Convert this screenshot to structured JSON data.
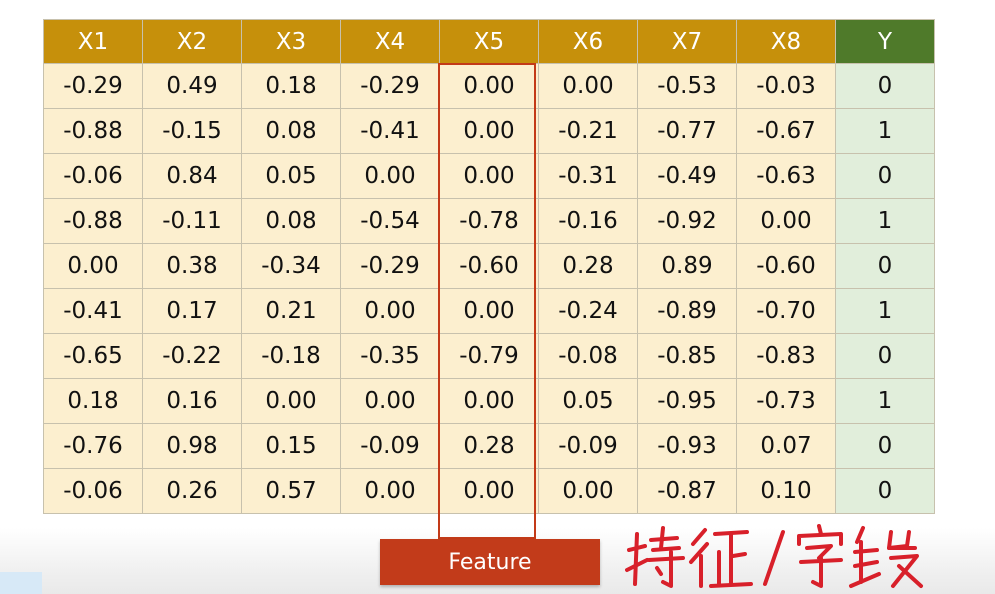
{
  "table": {
    "headers": [
      "X1",
      "X2",
      "X3",
      "X4",
      "X5",
      "X6",
      "X7",
      "X8",
      "Y"
    ],
    "rows": [
      [
        "-0.29",
        "0.49",
        "0.18",
        "-0.29",
        "0.00",
        "0.00",
        "-0.53",
        "-0.03",
        "0"
      ],
      [
        "-0.88",
        "-0.15",
        "0.08",
        "-0.41",
        "0.00",
        "-0.21",
        "-0.77",
        "-0.67",
        "1"
      ],
      [
        "-0.06",
        "0.84",
        "0.05",
        "0.00",
        "0.00",
        "-0.31",
        "-0.49",
        "-0.63",
        "0"
      ],
      [
        "-0.88",
        "-0.11",
        "0.08",
        "-0.54",
        "-0.78",
        "-0.16",
        "-0.92",
        "0.00",
        "1"
      ],
      [
        "0.00",
        "0.38",
        "-0.34",
        "-0.29",
        "-0.60",
        "0.28",
        "0.89",
        "-0.60",
        "0"
      ],
      [
        "-0.41",
        "0.17",
        "0.21",
        "0.00",
        "0.00",
        "-0.24",
        "-0.89",
        "-0.70",
        "1"
      ],
      [
        "-0.65",
        "-0.22",
        "-0.18",
        "-0.35",
        "-0.79",
        "-0.08",
        "-0.85",
        "-0.83",
        "0"
      ],
      [
        "0.18",
        "0.16",
        "0.00",
        "0.00",
        "0.00",
        "0.05",
        "-0.95",
        "-0.73",
        "1"
      ],
      [
        "-0.76",
        "0.98",
        "0.15",
        "-0.09",
        "0.28",
        "-0.09",
        "-0.93",
        "0.07",
        "0"
      ],
      [
        "-0.06",
        "0.26",
        "0.57",
        "0.00",
        "0.00",
        "0.00",
        "-0.87",
        "0.10",
        "0"
      ]
    ]
  },
  "highlight": {
    "column": "X5",
    "label": "Feature",
    "color": "#c33a18"
  },
  "annotation": {
    "text": "特征/字段",
    "color": "#d8202a"
  },
  "colors": {
    "header_feature": "#c6900b",
    "header_target": "#4f7a2a",
    "cell_feature": "#fcefcf",
    "cell_target": "#e1eedb"
  }
}
